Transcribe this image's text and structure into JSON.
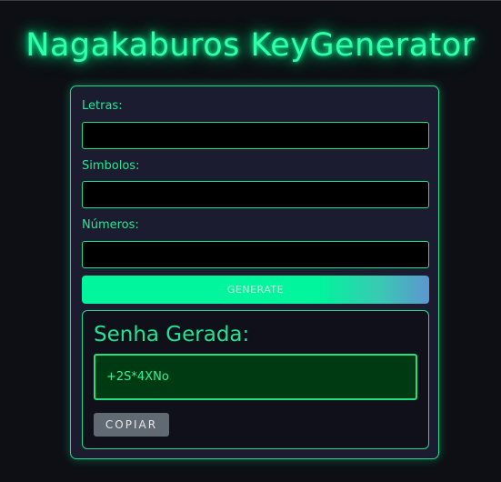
{
  "app": {
    "title": "Nagakaburos KeyGenerator"
  },
  "form": {
    "letters_label": "Letras:",
    "letters_value": "",
    "symbols_label": "Simbolos:",
    "symbols_value": "",
    "numbers_label": "Números:",
    "numbers_value": "",
    "generate_label": "generate"
  },
  "result": {
    "title": "Senha Gerada:",
    "password": "+2S*4XNo",
    "copy_label": "copiar"
  },
  "colors": {
    "background": "#0d0f14",
    "panel": "#1b1c30",
    "accent": "#1fdc91",
    "glow": "#00ff99",
    "password_bg": "#003a12",
    "copy_button": "#616a72"
  }
}
